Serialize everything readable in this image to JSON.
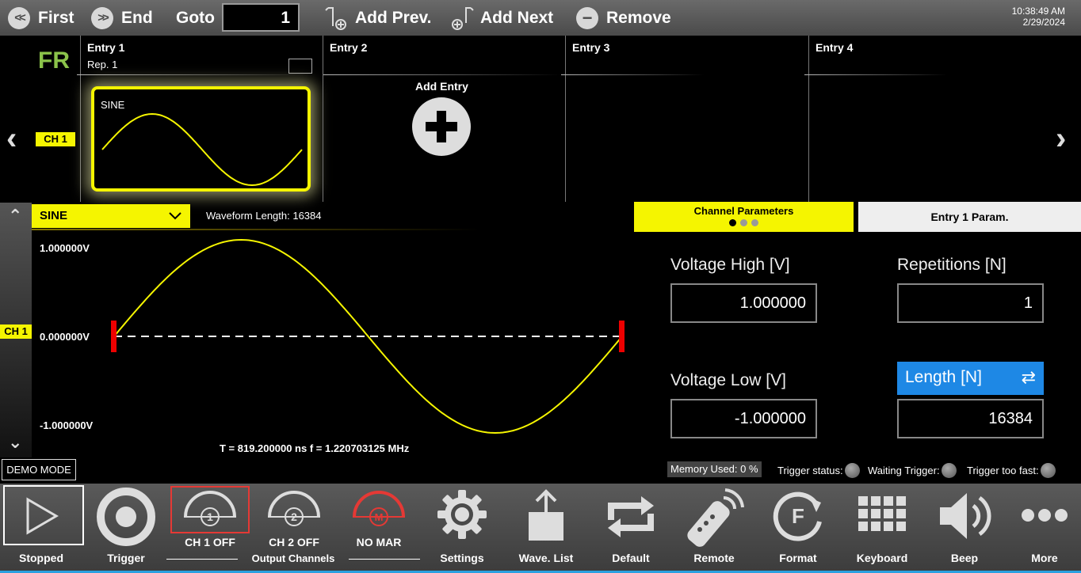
{
  "topbar": {
    "first": "First",
    "end": "End",
    "goto_label": "Goto",
    "goto_value": "1",
    "add_prev": "Add Prev.",
    "add_next": "Add Next",
    "remove": "Remove",
    "time": "10:38:49 AM",
    "date": "2/29/2024"
  },
  "entries": {
    "mode": "FR",
    "channel": "CH 1",
    "columns": [
      {
        "title": "Entry  1",
        "rep": "Rep.  1",
        "waveform": "SINE"
      },
      {
        "title": "Entry  2",
        "add_label": "Add Entry"
      },
      {
        "title": "Entry  3"
      },
      {
        "title": "Entry  4"
      }
    ]
  },
  "waveform": {
    "type": "SINE",
    "length_label": "Waveform Length:  16384",
    "v_high": "1.000000V",
    "v_mid": "0.000000V",
    "v_low": "-1.000000V",
    "side_channel": "CH 1",
    "period_freq": "T =  819.200000 ns   f =  1.220703125 MHz",
    "demo": "DEMO MODE"
  },
  "params": {
    "tab_active": "Channel Parameters",
    "tab_inactive": "Entry  1  Param.",
    "voltage_high_label": "Voltage High [V]",
    "voltage_high": "1.000000",
    "voltage_low_label": "Voltage Low [V]",
    "voltage_low": "-1.000000",
    "repetitions_label": "Repetitions [N]",
    "repetitions": "1",
    "length_label": "Length [N]",
    "length": "16384"
  },
  "status": {
    "memory": "Memory Used:   0 %",
    "trigger_status": "Trigger status:",
    "waiting_trigger": "Waiting Trigger:",
    "trigger_too_fast": "Trigger too fast:"
  },
  "toolbar": {
    "stopped": "Stopped",
    "trigger": "Trigger",
    "ch1": "CH 1 OFF",
    "ch1_num": "1",
    "ch2": "CH 2 OFF",
    "ch2_num": "2",
    "marker": "NO MAR",
    "marker_letter": "M",
    "output_channels": "Output Channels",
    "settings": "Settings",
    "wave_list": "Wave. List",
    "default": "Default",
    "remote": "Remote",
    "format": "Format",
    "keyboard": "Keyboard",
    "beep": "Beep",
    "more": "More"
  },
  "colors": {
    "accent_yellow": "#f5f500",
    "accent_blue": "#1e88e5",
    "marker_red": "#e53935",
    "mode_green": "#8bc34a"
  }
}
